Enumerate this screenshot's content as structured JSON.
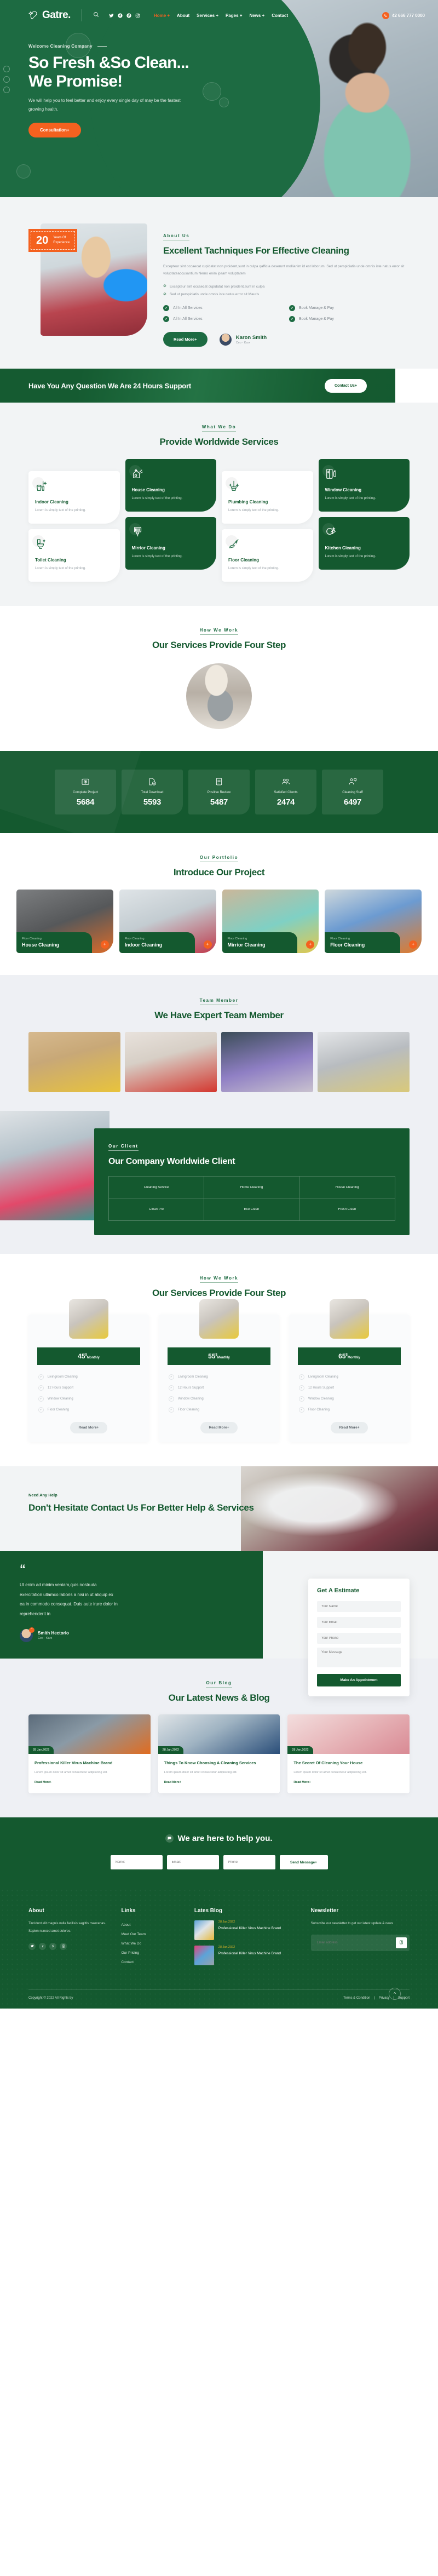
{
  "header": {
    "logo_text": "Gatre.",
    "search_icon": "search-icon",
    "socials": [
      "twitter-icon",
      "facebook-icon",
      "pinterest-icon",
      "instagram-icon"
    ],
    "menu": [
      {
        "label": "Home +",
        "active": true
      },
      {
        "label": "About",
        "active": false
      },
      {
        "label": "Services +",
        "active": false
      },
      {
        "label": "Pages +",
        "active": false
      },
      {
        "label": "News +",
        "active": false
      },
      {
        "label": "Contact",
        "active": false
      }
    ],
    "phone_icon": "phone-icon",
    "phone": "42 666 777 0000"
  },
  "hero": {
    "kicker": "Welcome Cleaning Company",
    "title_line1": "So Fresh &So Clean...",
    "title_line2": "We Promise!",
    "paragraph": "We will help you to feel better and enjoy every single day of may be the fastest growing health.",
    "cta": "Consultation+"
  },
  "about": {
    "badge_number": "20",
    "badge_label_1": "Years Of",
    "badge_label_2": "Experience",
    "kicker": "About Us",
    "title": "Excellent Tachniques For Effective Cleaning",
    "paragraph": "Excepteur sint occaecat cupidatat non proident,sunt in culpa qafficia deserunt mollianim id est laborum. Sed ut perspiciatis unde omnis iste natus error sit voluptateaccusantium Nemo enim ipsam voluptatem",
    "bullets": [
      "Excepteur sint occaecat cupidatat non proident,sunt in culpa",
      "Sed ut perspiciatis unde omnis iste natus error sit Mauris"
    ],
    "features": [
      "All In All Services",
      "Book Manage & Pay",
      "All In All Services",
      "Book Manage & Pay"
    ],
    "button": "Read More+",
    "signature_name": "Karon Smith",
    "signature_role": "Ceo - Karx"
  },
  "cta_band": {
    "title": "Have You Any Question We Are 24 Hours Support",
    "button": "Contact Us+"
  },
  "services": {
    "kicker": "What We Do",
    "title": "Provide Worldwide Services",
    "items": [
      {
        "name": "Indoor Cleaning",
        "desc": "Lorem is simply text of the printing.",
        "icon": "bucket-broom-icon",
        "dark": false
      },
      {
        "name": "House Cleaning",
        "desc": "Lorem is simply text of the printing.",
        "icon": "house-broom-icon",
        "dark": true
      },
      {
        "name": "Plumbing Cleaning",
        "desc": "Lorem is simply text of the printing.",
        "icon": "mop-icon",
        "dark": false
      },
      {
        "name": "Window Cleaning",
        "desc": "Lorem is simply text of the printing.",
        "icon": "window-spray-icon",
        "dark": true
      },
      {
        "name": "Toilet Cleaning",
        "desc": "Lorem is simply text of the printing.",
        "icon": "toilet-icon",
        "dark": false
      },
      {
        "name": "Mirrior Cleaning",
        "desc": "Lorem is simply text of the printing.",
        "icon": "mirror-squeegee-icon",
        "dark": true
      },
      {
        "name": "Floor Cleaning",
        "desc": "Lorem is simply text of the printing.",
        "icon": "floor-mop-icon",
        "dark": false
      },
      {
        "name": "Kitchen Cleaning",
        "desc": "Lorem is simply text of the printing.",
        "icon": "dish-sponge-icon",
        "dark": true
      }
    ]
  },
  "work": {
    "kicker": "How We Work",
    "title": "Our Services Provide Four Step"
  },
  "stats": [
    {
      "label": "Complete Project",
      "value": "5684",
      "icon": "target-camera-icon"
    },
    {
      "label": "Total Download",
      "value": "5593",
      "icon": "download-file-icon"
    },
    {
      "label": "Positive Review",
      "value": "5487",
      "icon": "review-doc-icon"
    },
    {
      "label": "Satisfied Clients",
      "value": "2474",
      "icon": "people-group-icon"
    },
    {
      "label": "Cleaning Staff",
      "value": "6497",
      "icon": "staff-icon"
    }
  ],
  "portfolio": {
    "kicker": "Our Portfolio",
    "title": "Introduce Our Project",
    "items": [
      {
        "sub": "Floor Cleaning",
        "title": "House Cleaning"
      },
      {
        "sub": "Floor Cleaning",
        "title": "Indoor Cleaning"
      },
      {
        "sub": "Floor Cleaning",
        "title": "Mirrior Cleaning"
      },
      {
        "sub": "Floor Cleaning",
        "title": "Floor Cleaning"
      }
    ],
    "plus_icon": "plus-icon"
  },
  "team": {
    "kicker": "Team Member",
    "title": "We Have Expert Team Member",
    "members": [
      "member-1",
      "member-2",
      "member-3",
      "member-4"
    ]
  },
  "clients": {
    "kicker": "Our Client",
    "title": "Our Company Worldwide Client",
    "logos": [
      "Cleaning Service",
      "Home Cleaning",
      "House Cleaning",
      "Clean Pro",
      "Eco Clean",
      "Fresh Clean"
    ]
  },
  "pricing": {
    "kicker": "How We Work",
    "title": "Our Services Provide Four Step",
    "plans": [
      {
        "price": "45",
        "currency": "$",
        "period": "Monthly",
        "features": [
          "Livingroom Cleaning",
          "12 Hours Support",
          "Window Cleaning",
          "Floor Cleaning"
        ],
        "button": "Read More+"
      },
      {
        "price": "55",
        "currency": "$",
        "period": "Monthly",
        "features": [
          "Livingroom Cleaning",
          "12 Hours Support",
          "Window Cleaning",
          "Floor Cleaning"
        ],
        "button": "Read More+"
      },
      {
        "price": "65",
        "currency": "$",
        "period": "Monthly",
        "features": [
          "Livingroom Cleaning",
          "12 Hours Support",
          "Window Cleaning",
          "Floor Cleaning"
        ],
        "button": "Read More+"
      }
    ]
  },
  "contact": {
    "kicker": "Need Any Help",
    "title": "Don't Hesitate Contact Us For Better Help & Services",
    "quote_mark": "“",
    "testimonial": "Ut enim ad minim veniam,quis nostruda exercitation ullamco laboris a nisi in ut aliquip ex ea in commodo consequat. Duis aute irure dolor in reprehenderit in",
    "author_name": "Smith Hectorio",
    "author_role": "Ceo - Karx",
    "quote_icon": "quote-icon"
  },
  "estimate": {
    "title": "Get A Estimate",
    "name_placeholder": "Your Name",
    "email_placeholder": "Your Email",
    "phone_placeholder": "Your Phone",
    "message_placeholder": "Your Message",
    "button": "Make An Appointment"
  },
  "blog": {
    "kicker": "Our Blog",
    "title": "Our Latest News & Blog",
    "posts": [
      {
        "date": "28 Jan,2022",
        "title": "Professional Killer Virus Machine Brand",
        "desc": "Lorem ipsum dolor sit amet consectetur adipisicing elit.",
        "more": "Read More+"
      },
      {
        "date": "28 Jan,2022",
        "title": "Things To Know Choosing A Cleaning Services",
        "desc": "Lorem ipsum dolor sit amet consectetur adipisicing elit.",
        "more": "Read More+"
      },
      {
        "date": "28 Jan,2022",
        "title": "The Secret Of Cleaning Your House",
        "desc": "Lorem ipsum dolor sit amet consectetur adipisicing elit.",
        "more": "Read More+"
      }
    ]
  },
  "help": {
    "title": "We are here to help you.",
    "icon": "chat-icon",
    "name_placeholder": "Name:",
    "email_placeholder": "Email:",
    "phone_placeholder": "Phone:",
    "button": "Send Message+"
  },
  "footer": {
    "about_title": "About",
    "about_text": "Tincidunt elit magnis nulla facilisis sagittis maecenas. Sapien nunced amet dolores.",
    "socials": [
      "twitter-icon",
      "facebook-icon",
      "pinterest-icon",
      "instagram-icon"
    ],
    "links_title": "Links",
    "links": [
      "About",
      "Meet Our Team",
      "What We Do",
      "Our Pricing",
      "Contact"
    ],
    "blog_title": "Lates Blog",
    "posts": [
      {
        "date": "28 Jan,2022",
        "title": "Professional Killer Virus Machine Brand"
      },
      {
        "date": "28 Jan,2022",
        "title": "Professional Killer Virus Machine Brand"
      }
    ],
    "newsletter_title": "Newsletter",
    "newsletter_text": "Subscribe our newsletter to get our latest update & news",
    "newsletter_placeholder": "Email address",
    "newsletter_icon": "send-icon",
    "copyright": "Copyright © 2022 All Rights by",
    "legal": [
      "Terms & Condition",
      "Privacy",
      "Support"
    ],
    "to_top_icon": "chevron-up-icon"
  },
  "colors": {
    "green": "#14592f",
    "green_light": "#1d6b42",
    "orange": "#f4611f",
    "bg_grey": "#f2f4f5"
  }
}
